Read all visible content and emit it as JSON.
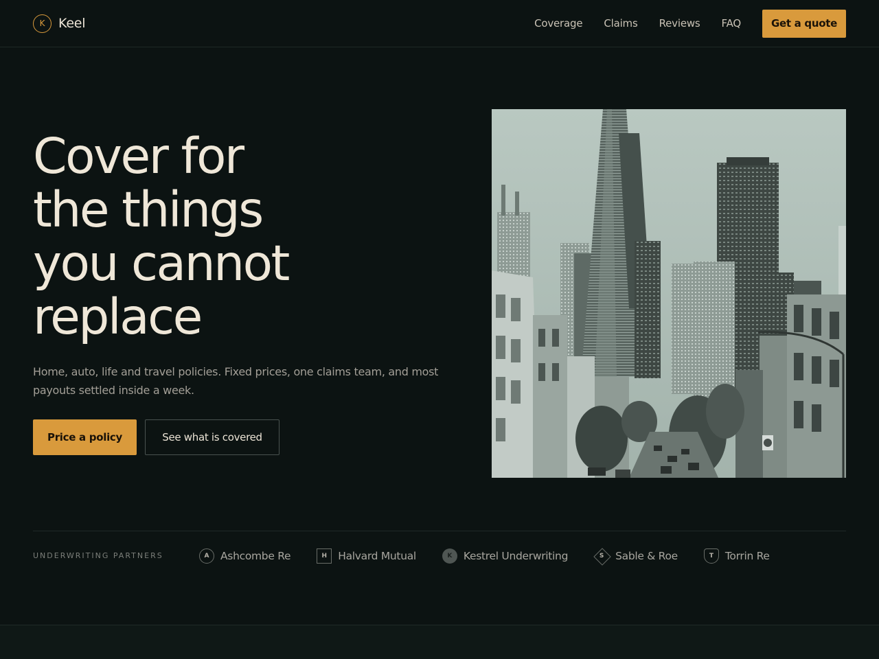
{
  "brand": {
    "name": "Keel",
    "mark_letter": "K"
  },
  "nav": {
    "links": [
      "Coverage",
      "Claims",
      "Reviews",
      "FAQ"
    ],
    "cta": "Get a quote"
  },
  "hero": {
    "title_lines": [
      "Cover for",
      "the things",
      "you cannot",
      "replace"
    ],
    "subtitle": "Home, auto, life and travel policies. Fixed prices, one claims team, and most payouts settled inside a week.",
    "primary_cta": "Price a policy",
    "secondary_cta": "See what is covered"
  },
  "partners": {
    "label": "UNDERWRITING PARTNERS",
    "items": [
      {
        "name": "Ashcombe Re",
        "letter": "A",
        "icon": "circle-mark-icon"
      },
      {
        "name": "Halvard Mutual",
        "letter": "H",
        "icon": "square-mark-icon"
      },
      {
        "name": "Kestrel Underwriting",
        "letter": "K",
        "icon": "filled-circle-mark-icon"
      },
      {
        "name": "Sable & Roe",
        "letter": "S",
        "icon": "diamond-mark-icon"
      },
      {
        "name": "Torrin Re",
        "letter": "T",
        "icon": "shield-mark-icon"
      }
    ]
  },
  "colors": {
    "background": "#0c1312",
    "accent": "#d99a3c",
    "text": "#ece4d6"
  }
}
